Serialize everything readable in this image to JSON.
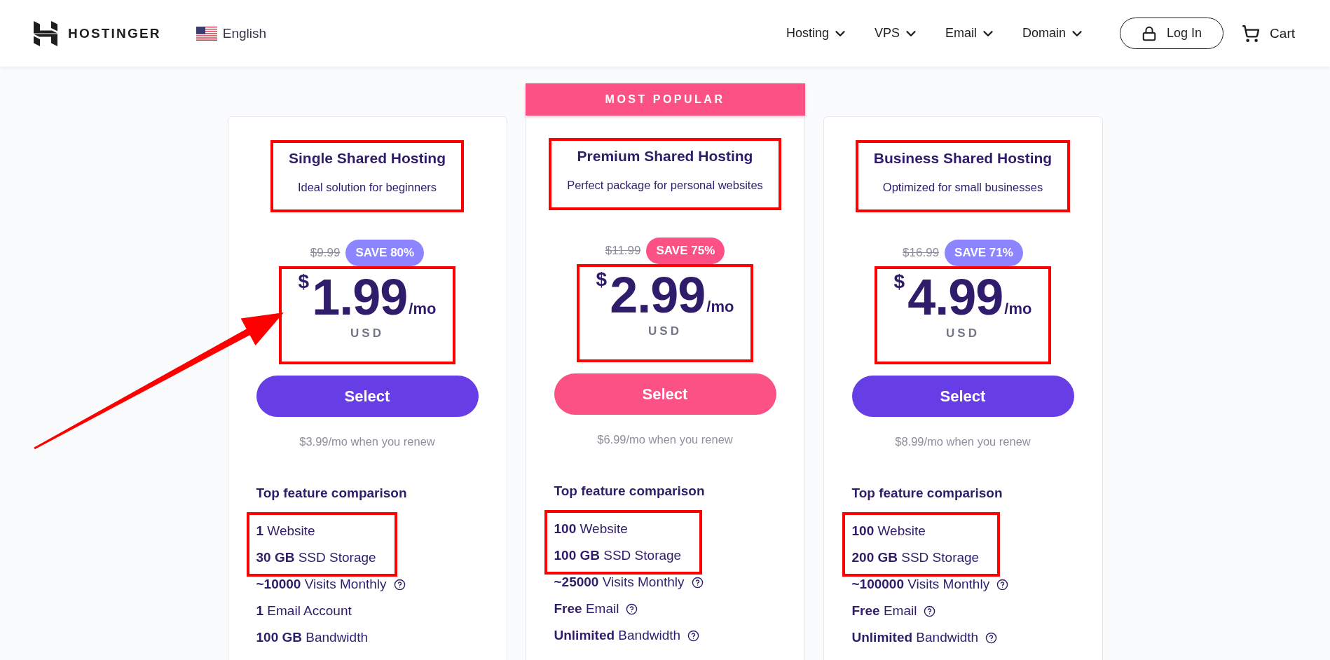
{
  "header": {
    "brand": "HOSTINGER",
    "language": "English",
    "nav": [
      "Hosting",
      "VPS",
      "Email",
      "Domain"
    ],
    "login": "Log In",
    "cart": "Cart"
  },
  "plans": [
    {
      "featured": false,
      "title": "Single Shared Hosting",
      "subtitle": "Ideal solution for beginners",
      "heading_annotated": true,
      "old_price": "$9.99",
      "discount": "SAVE 80%",
      "currency_symbol": "$",
      "price": "1.99",
      "period": "/mo",
      "currency": "USD",
      "price_annotated": true,
      "arrow": true,
      "button": "Select",
      "renewal": "$3.99/mo when you renew",
      "features_title": "Top feature comparison",
      "features": [
        {
          "text": "**1** Website",
          "help": false,
          "annotated": true
        },
        {
          "text": "**30 GB** SSD Storage",
          "help": false,
          "annotated": true
        },
        {
          "text": "**~10000** Visits Monthly",
          "help": true,
          "annotated": false
        },
        {
          "text": "**1** Email Account",
          "help": false,
          "annotated": false
        },
        {
          "text": "**100 GB** Bandwidth",
          "help": false,
          "annotated": false
        }
      ]
    },
    {
      "featured": true,
      "ribbon": "MOST POPULAR",
      "title": "Premium Shared Hosting",
      "subtitle": "Perfect package for personal websites",
      "heading_annotated": true,
      "old_price": "$11.99",
      "discount": "SAVE 75%",
      "currency_symbol": "$",
      "price": "2.99",
      "period": "/mo",
      "currency": "USD",
      "price_annotated": true,
      "arrow": false,
      "button": "Select",
      "renewal": "$6.99/mo when you renew",
      "features_title": "Top feature comparison",
      "features": [
        {
          "text": "**100** Website",
          "help": false,
          "annotated": true
        },
        {
          "text": "**100 GB** SSD Storage",
          "help": false,
          "annotated": true
        },
        {
          "text": "**~25000** Visits Monthly",
          "help": true,
          "annotated": false
        },
        {
          "text": "**Free** Email",
          "help": true,
          "annotated": false
        },
        {
          "text": "**Unlimited** Bandwidth",
          "help": true,
          "annotated": false
        }
      ]
    },
    {
      "featured": false,
      "title": "Business Shared Hosting",
      "subtitle": "Optimized for small businesses",
      "heading_annotated": true,
      "old_price": "$16.99",
      "discount": "SAVE 71%",
      "currency_symbol": "$",
      "price": "4.99",
      "period": "/mo",
      "currency": "USD",
      "price_annotated": true,
      "arrow": false,
      "button": "Select",
      "renewal": "$8.99/mo when you renew",
      "features_title": "Top feature comparison",
      "features": [
        {
          "text": "**100** Website",
          "help": false,
          "annotated": true
        },
        {
          "text": "**200 GB** SSD Storage",
          "help": false,
          "annotated": true
        },
        {
          "text": "**~100000** Visits Monthly",
          "help": true,
          "annotated": false
        },
        {
          "text": "**Free** Email",
          "help": true,
          "annotated": false
        },
        {
          "text": "**Unlimited** Bandwidth",
          "help": true,
          "annotated": false
        }
      ]
    }
  ]
}
